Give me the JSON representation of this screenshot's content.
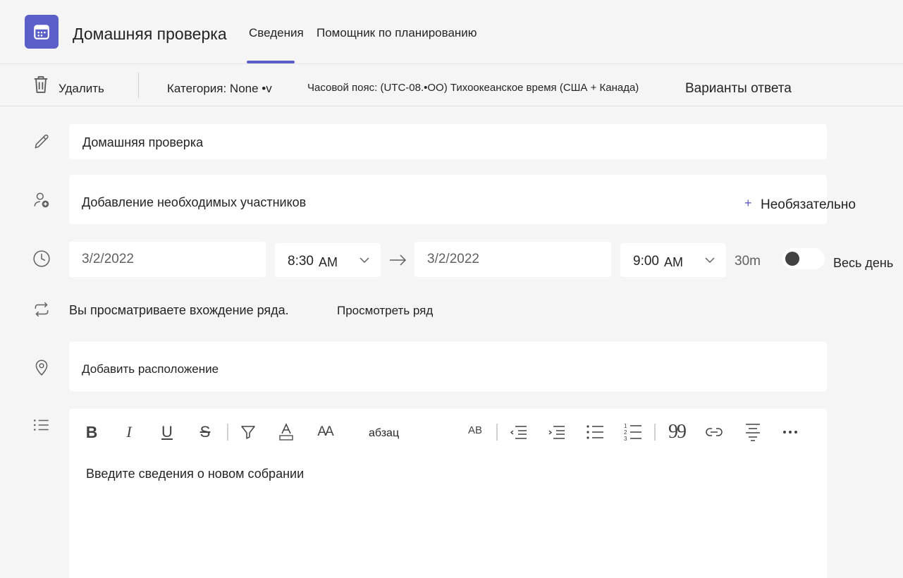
{
  "header": {
    "title": "Домашняя проверка",
    "tabs": [
      {
        "label": "Сведения"
      },
      {
        "label": "Помощник по планированию"
      }
    ]
  },
  "toolbar": {
    "delete_label": "Удалить",
    "category_label": "Категория: None •v",
    "timezone_label": "Часовой пояс: (UTC-08.•OO) Тихоокеанское время (США + Канада)",
    "response_options_label": "Варианты ответа"
  },
  "form": {
    "title_value": "Домашняя проверка",
    "attendees_placeholder": "Добавление необходимых участников",
    "optional_label": "Необязательно",
    "start_date": "3/2/2022",
    "start_time": "8:30",
    "start_ampm": "AM",
    "end_date": "3/2/2022",
    "end_time": "9:00",
    "end_ampm": "AM",
    "duration": "30m",
    "all_day_label": "Весь день",
    "recurrence_text": "Вы просматриваете вхождение ряда.",
    "view_series_label": "Просмотреть ряд",
    "location_placeholder": "Добавить расположение",
    "paragraph_style": "абзац",
    "spellcheck_label": "AB",
    "details_placeholder": "Введите сведения о новом собрании"
  },
  "colors": {
    "accent": "#5b5fc7",
    "background": "#f5f5f5",
    "field": "#ffffff"
  },
  "icons": [
    "calendar-icon",
    "trash-icon",
    "pencil-icon",
    "add-person-icon",
    "clock-icon",
    "repeat-icon",
    "location-icon",
    "list-icon"
  ]
}
